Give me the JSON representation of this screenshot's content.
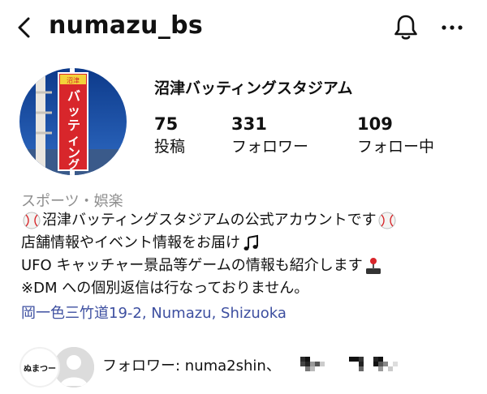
{
  "header": {
    "username": "numazu_bs",
    "back_icon": "chevron-left-icon",
    "bell_icon": "bell-icon",
    "more_icon": "more-horizontal-icon"
  },
  "profile": {
    "display_name": "沼津バッティングスタジアム",
    "avatar_sign_text": "バッティング",
    "stats": {
      "posts": {
        "value": "75",
        "label": "投稿"
      },
      "followers": {
        "value": "331",
        "label": "フォロワー"
      },
      "following": {
        "value": "109",
        "label": "フォロー中"
      }
    },
    "category": "スポーツ・娯楽",
    "bio": {
      "line1": "沼津バッティングスタジアムの公式アカウントです",
      "line2": "店舗情報やイベント情報をお届け",
      "line3": "UFO キャッチャー景品等ゲームの情報も紹介します",
      "line4": "※DM への個別返信は行なっておりません。"
    },
    "location": "岡一色三竹道19-2, Numazu, Shizuoka"
  },
  "mutual": {
    "avatar_text": "ぬまつー",
    "text": "フォロワー: numa2shin、"
  },
  "colors": {
    "link": "#3d4fa0",
    "muted": "#8e8e8e",
    "sign_red": "#d8262b"
  }
}
